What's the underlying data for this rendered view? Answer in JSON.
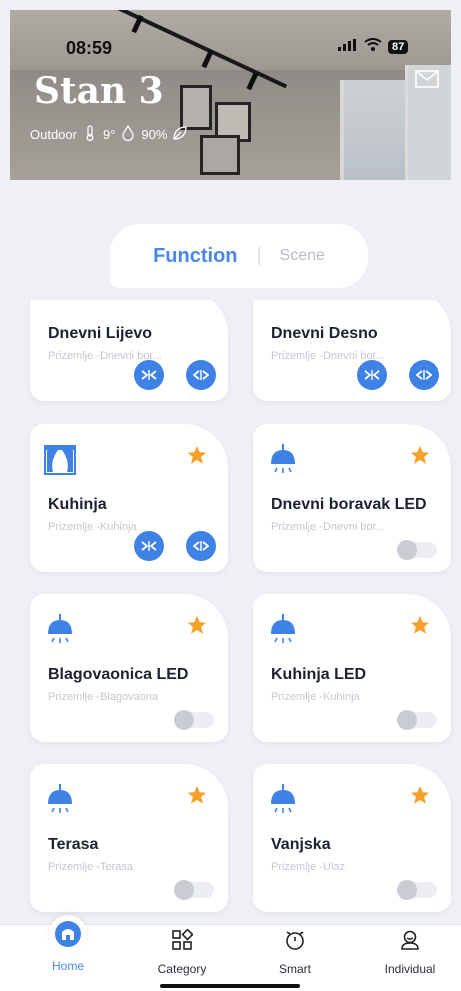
{
  "status": {
    "time": "08:59",
    "battery": "87"
  },
  "header": {
    "title": "Stan 3",
    "outdoor_label": "Outdoor",
    "temperature": "9°",
    "humidity": "90%"
  },
  "tabs": {
    "active": "Function",
    "inactive": "Scene"
  },
  "devices": [
    {
      "name": "Dnevni Lijevo",
      "location": "Prizemlje -Dnevni bor...",
      "type": "curtain",
      "control": "buttons"
    },
    {
      "name": "Dnevni Desno",
      "location": "Prizemlje -Dnevni bor...",
      "type": "curtain",
      "control": "buttons"
    },
    {
      "name": "Kuhinja",
      "location": "Prizemlje -Kuhinja",
      "type": "curtain",
      "control": "buttons"
    },
    {
      "name": "Dnevni boravak LED",
      "location": "Prizemlje -Dnevni bor...",
      "type": "light",
      "control": "toggle"
    },
    {
      "name": "Blagovaonica LED",
      "location": "Prizemlje -Blagovaona",
      "type": "light",
      "control": "toggle"
    },
    {
      "name": "Kuhinja LED",
      "location": "Prizemlje -Kuhinja",
      "type": "light",
      "control": "toggle"
    },
    {
      "name": "Terasa",
      "location": "Prizemlje -Terasa",
      "type": "light",
      "control": "toggle"
    },
    {
      "name": "Vanjska",
      "location": "Prizemlje -Ulaz",
      "type": "light",
      "control": "toggle"
    }
  ],
  "nav": {
    "home": "Home",
    "category": "Category",
    "smart": "Smart",
    "individual": "Individual"
  },
  "colors": {
    "accent": "#4a86e8",
    "star": "#f5a02a",
    "control_blue": "#3f82e6"
  }
}
